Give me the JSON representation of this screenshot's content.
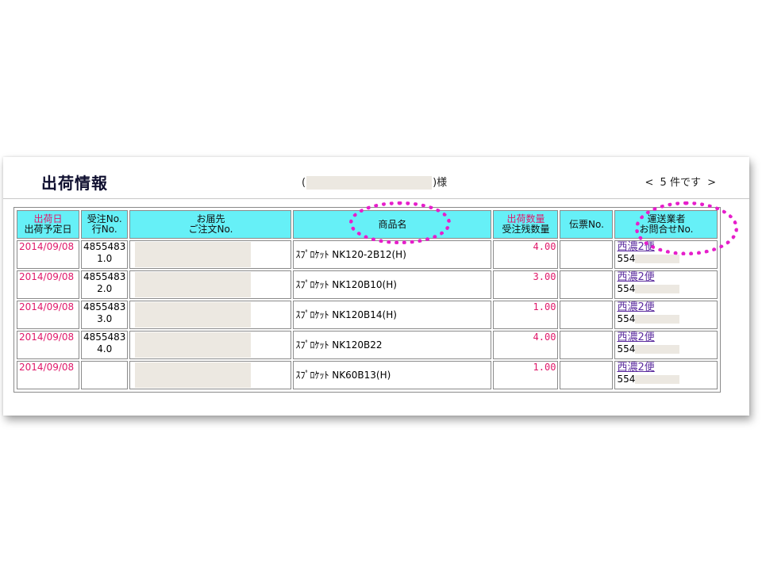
{
  "page": {
    "title": "出荷情報",
    "customer_open": "(",
    "customer_suffix": ")様",
    "count_text": "5 件です",
    "prev_label": "<",
    "next_label": ">"
  },
  "table": {
    "headers": {
      "ship_date_line1": "出荷日",
      "ship_date_line2": "出荷予定日",
      "order_line1": "受注No.",
      "order_line2": "行No.",
      "dest_line1": "お届先",
      "dest_line2": "ご注文No.",
      "product": "商品名",
      "qty_line1": "出荷数量",
      "qty_line2": "受注残数量",
      "slip": "伝票No.",
      "carrier_line1": "運送業者",
      "carrier_line2": "お問合せNo."
    },
    "rows": [
      {
        "date": "2014/09/08",
        "order_no": "4855483",
        "line_no": "1.0",
        "product": "ｽﾌﾟﾛｹｯﾄ NK120-2B12(H)",
        "qty": "4.00",
        "carrier": "西濃2便",
        "inquiry": "554"
      },
      {
        "date": "2014/09/08",
        "order_no": "4855483",
        "line_no": "2.0",
        "product": "ｽﾌﾟﾛｹｯﾄ NK120B10(H)",
        "qty": "3.00",
        "carrier": "西濃2便",
        "inquiry": "554"
      },
      {
        "date": "2014/09/08",
        "order_no": "4855483",
        "line_no": "3.0",
        "product": "ｽﾌﾟﾛｹｯﾄ NK120B14(H)",
        "qty": "1.00",
        "carrier": "西濃2便",
        "inquiry": "554"
      },
      {
        "date": "2014/09/08",
        "order_no": "4855483",
        "line_no": "4.0",
        "product": "ｽﾌﾟﾛｹｯﾄ NK120B22",
        "qty": "4.00",
        "carrier": "西濃2便",
        "inquiry": "554"
      },
      {
        "date": "2014/09/08",
        "order_no": "",
        "line_no": "",
        "product": "ｽﾌﾟﾛｹｯﾄ NK60B13(H)",
        "qty": "1.00",
        "carrier": "西濃2便",
        "inquiry": "554"
      }
    ]
  },
  "colors": {
    "header_bg": "#66f0f7",
    "accent_pink": "#e0186a",
    "highlight_magenta": "#e61ecb",
    "link_purple": "#5a2a9e"
  }
}
